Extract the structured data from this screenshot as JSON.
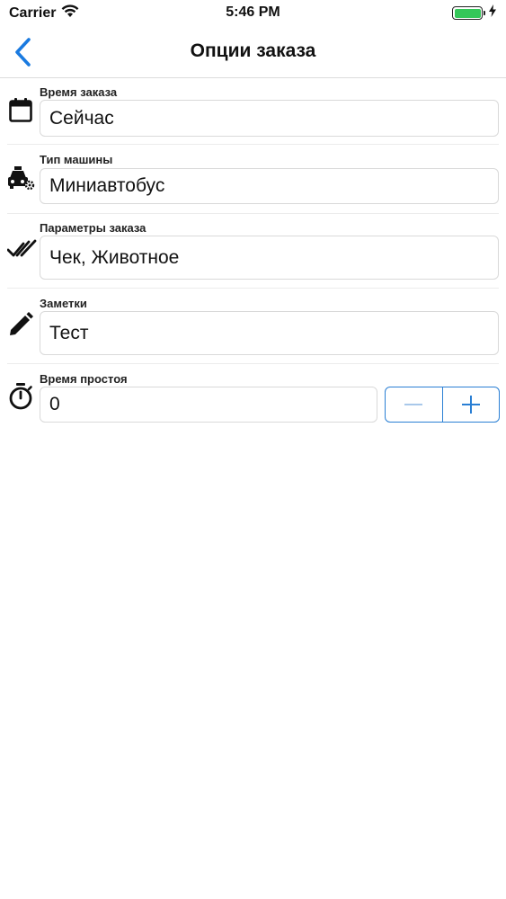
{
  "status_bar": {
    "carrier": "Carrier",
    "time": "5:46 PM",
    "battery_color": "#34c759"
  },
  "nav": {
    "title": "Опции заказа",
    "back_icon": "chevron-left-icon",
    "accent": "#1a7ae0"
  },
  "fields": {
    "order_time": {
      "label": "Время заказа",
      "value": "Сейчас",
      "icon": "calendar-icon"
    },
    "car_type": {
      "label": "Тип машины",
      "value": "Миниавтобус",
      "icon": "taxi-settings-icon"
    },
    "order_params": {
      "label": "Параметры заказа",
      "value": "Чек, Животное",
      "icon": "double-check-icon"
    },
    "notes": {
      "label": "Заметки",
      "value": "Тест",
      "icon": "pencil-icon"
    },
    "idle_time": {
      "label": "Время простоя",
      "value": "0",
      "icon": "stopwatch-icon",
      "decrement_icon": "minus-icon",
      "increment_icon": "plus-icon"
    }
  }
}
